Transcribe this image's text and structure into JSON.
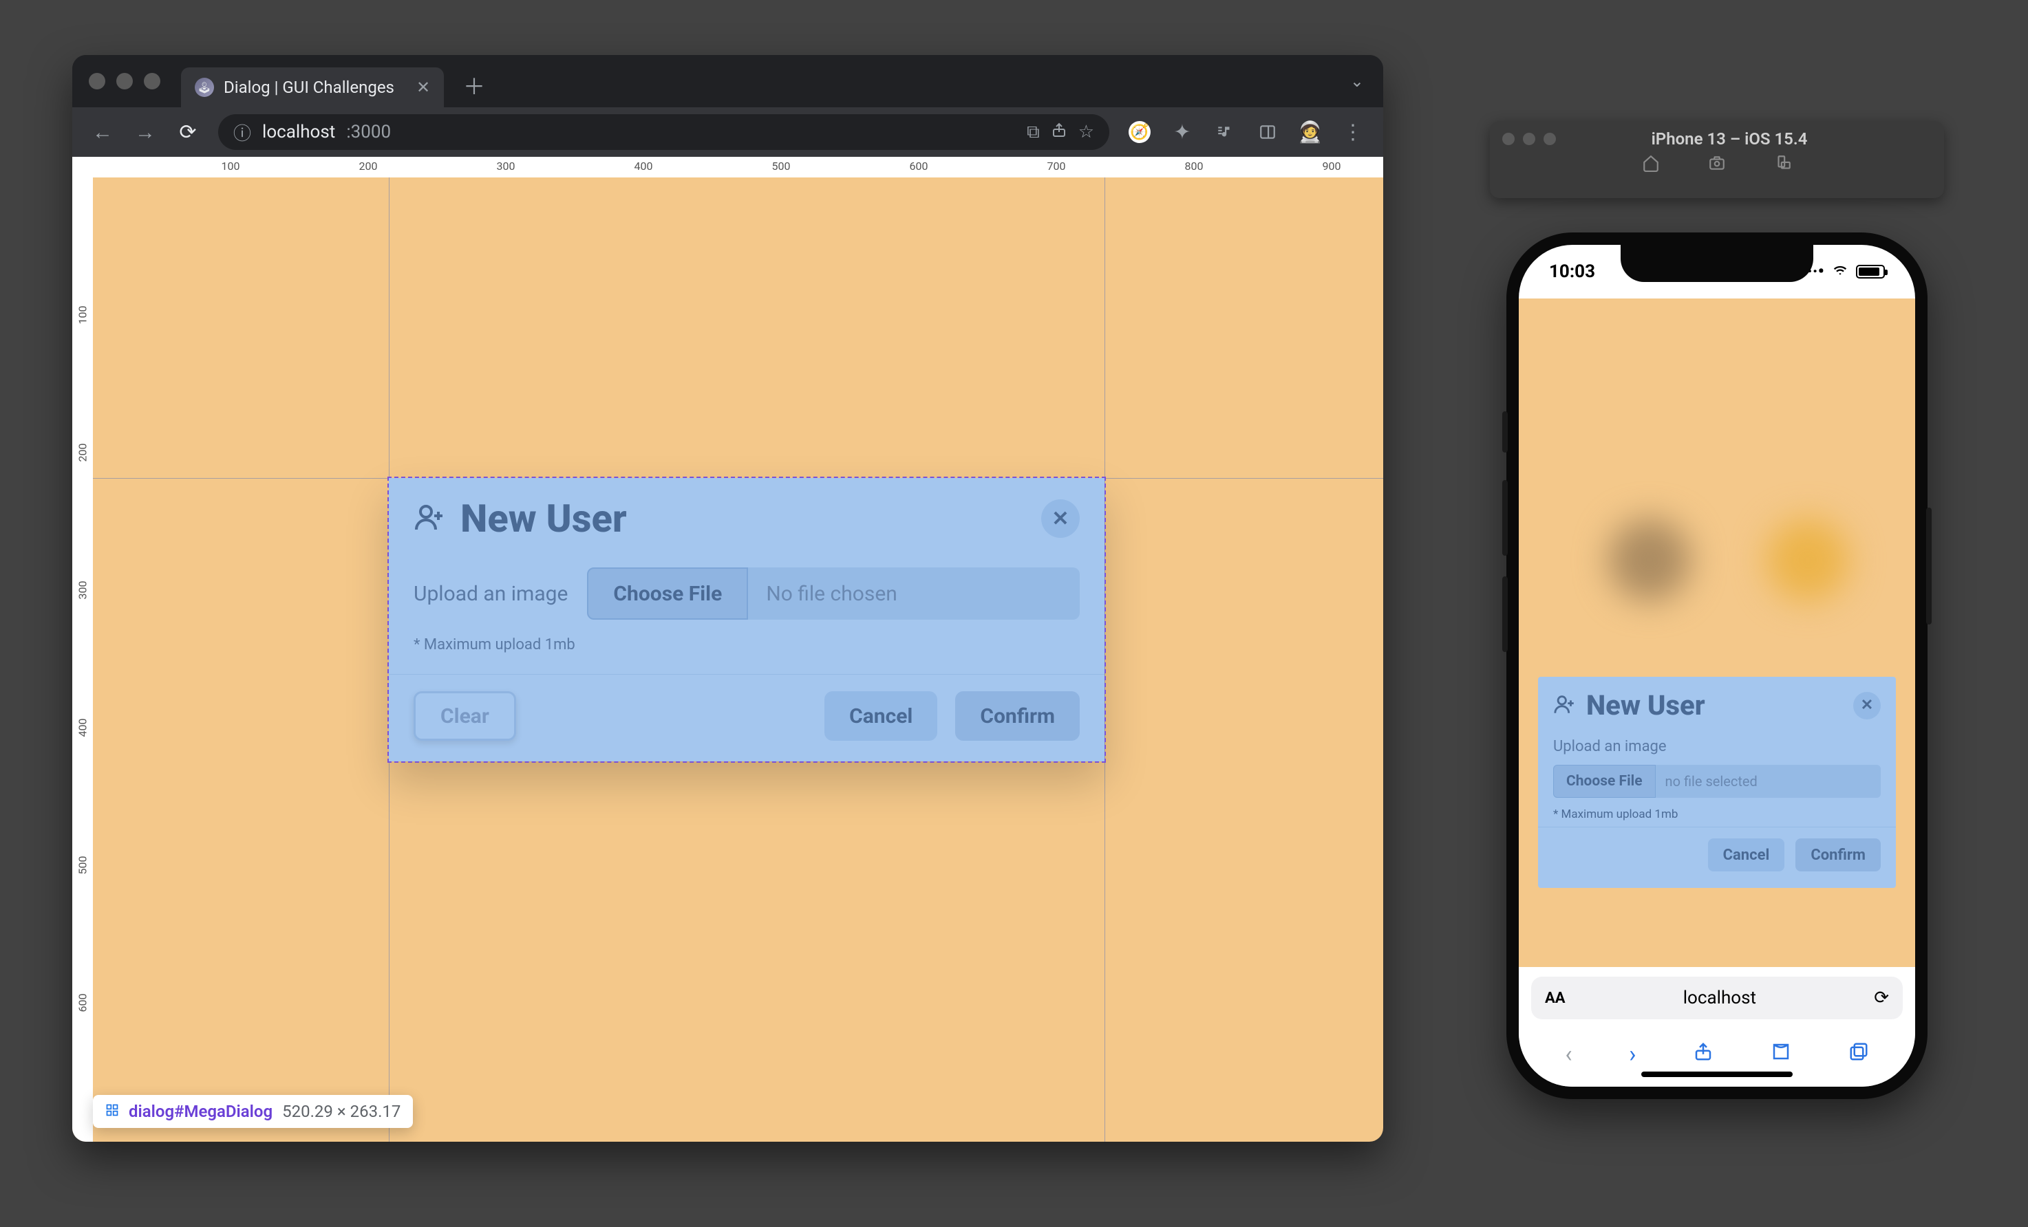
{
  "browser": {
    "tab_title": "Dialog | GUI Challenges",
    "url_host": "localhost",
    "url_port": ":3000",
    "ruler_h": [
      "100",
      "200",
      "300",
      "400",
      "500",
      "600",
      "700",
      "800",
      "900"
    ],
    "ruler_v": [
      "100",
      "200",
      "300",
      "400",
      "500",
      "600"
    ],
    "tooltip": {
      "selector": "dialog#MegaDialog",
      "dims": "520.29 × 263.17"
    }
  },
  "dialog": {
    "title": "New User",
    "upload_label": "Upload an image",
    "choose_file": "Choose File",
    "file_name": "No file chosen",
    "hint": "* Maximum upload 1mb",
    "buttons": {
      "clear": "Clear",
      "cancel": "Cancel",
      "confirm": "Confirm"
    }
  },
  "simulator": {
    "title": "iPhone 13 – iOS 15.4"
  },
  "phone": {
    "time": "10:03",
    "address": "localhost",
    "dialog": {
      "title": "New User",
      "upload_label": "Upload an image",
      "choose_file": "Choose File",
      "file_name": "no file selected",
      "hint": "* Maximum upload 1mb",
      "buttons": {
        "cancel": "Cancel",
        "confirm": "Confirm"
      }
    }
  }
}
